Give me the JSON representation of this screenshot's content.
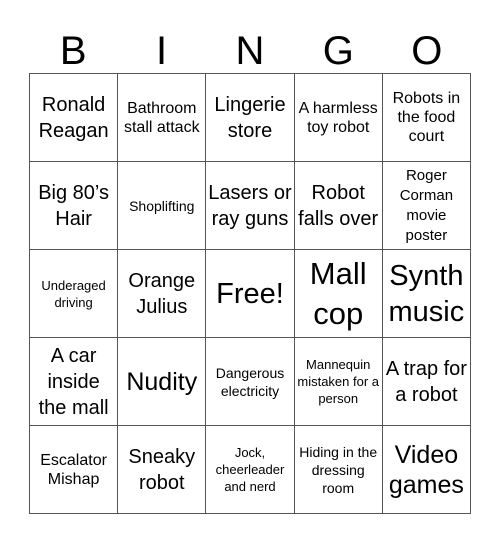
{
  "header": [
    "B",
    "I",
    "N",
    "G",
    "O"
  ],
  "cells": [
    [
      "Ronald Reagan",
      "Bathroom stall attack",
      "Lingerie store",
      "A harmless toy robot",
      "Robots in the food court"
    ],
    [
      "Big 80’s Hair",
      "Shoplifting",
      "Lasers or ray guns",
      "Robot falls over",
      "Roger Corman movie poster"
    ],
    [
      "Underaged driving",
      "Orange Julius",
      "Free!",
      "Mall cop",
      "Synth music"
    ],
    [
      "A car inside the mall",
      "Nudity",
      "Dangerous electricity",
      "Mannequin mistaken for a person",
      "A trap for a robot"
    ],
    [
      "Escalator Mishap",
      "Sneaky robot",
      "Jock, cheerleader and nerd",
      "Hiding in the dressing room",
      "Video games"
    ]
  ],
  "free_space": "Free!"
}
